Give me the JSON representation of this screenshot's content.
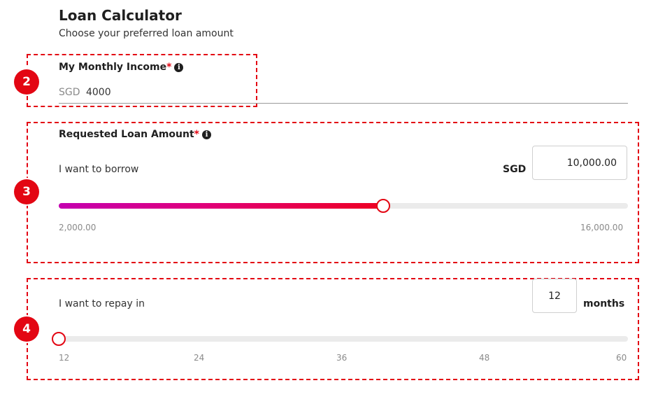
{
  "header": {
    "title": "Loan Calculator",
    "subtitle": "Choose your preferred loan amount"
  },
  "badges": [
    "2",
    "3",
    "4"
  ],
  "income": {
    "label": "My Monthly Income",
    "required_mark": "*",
    "info_icon": "info-icon",
    "currency": "SGD",
    "value": "4000"
  },
  "loan": {
    "label": "Requested Loan Amount",
    "required_mark": "*",
    "info_icon": "info-icon",
    "prompt": "I want to borrow",
    "currency": "SGD",
    "amount": "10,000.00",
    "min_label": "2,000.00",
    "max_label": "16,000.00",
    "slider_fraction": 0.57
  },
  "tenure": {
    "prompt": "I want to repay in",
    "value": "12",
    "unit": "months",
    "ticks": [
      "12",
      "24",
      "36",
      "48",
      "60"
    ],
    "slider_fraction": 0.0
  },
  "colors": {
    "accent": "#e30613",
    "gradient_start": "#c400b0",
    "gradient_end": "#ee0022",
    "track": "#ebebeb"
  }
}
